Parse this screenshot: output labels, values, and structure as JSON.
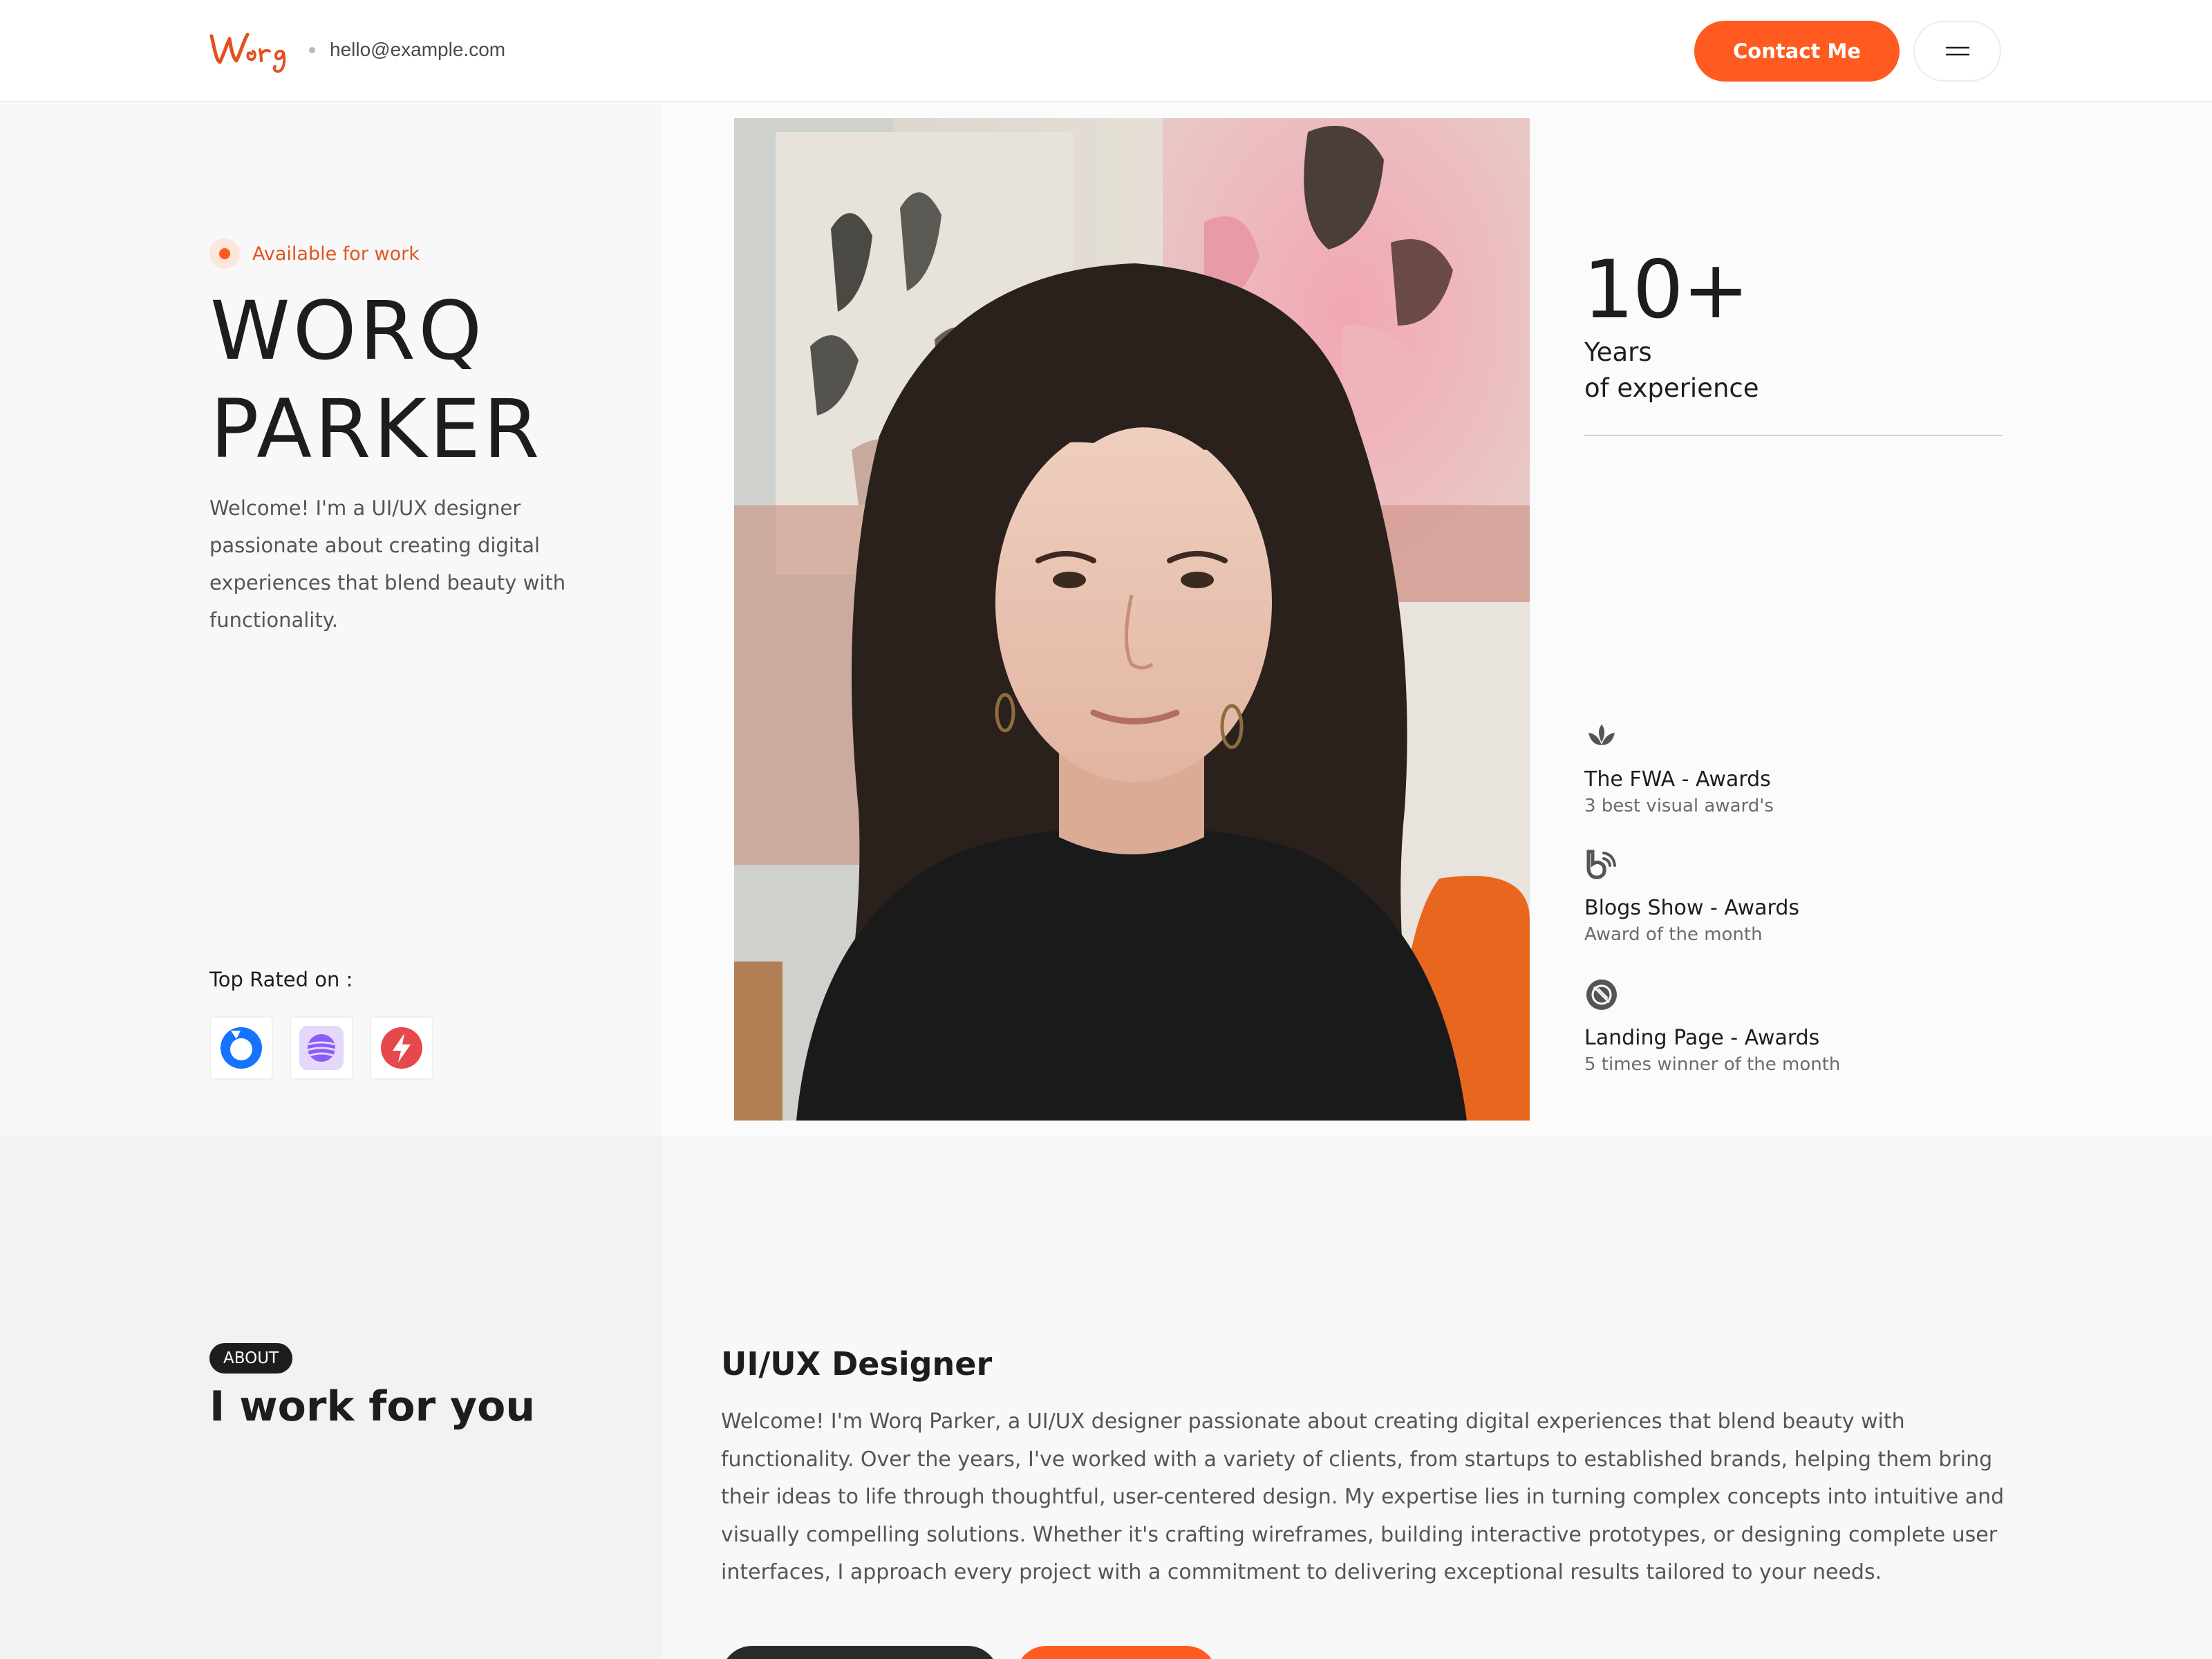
{
  "header": {
    "email": "hello@example.com",
    "contact_label": "Contact Me",
    "accent_color": "#ff5a1f"
  },
  "hero": {
    "availability": "Available for work",
    "name_line1": "WORQ",
    "name_line2": "PARKER",
    "description": "Welcome! I'm a UI/UX designer passionate about creating digital experiences that blend beauty with functionality.",
    "top_rated_label": "Top Rated on :",
    "platforms": [
      {
        "icon": "blue-ring-icon"
      },
      {
        "icon": "purple-sphere-icon"
      },
      {
        "icon": "red-bolt-icon"
      }
    ]
  },
  "stats": {
    "number": "10+",
    "label_line1": "Years",
    "label_line2": "of experience"
  },
  "awards": [
    {
      "icon": "lotus-icon",
      "title": "The FWA - Awards",
      "subtitle": "3 best visual award's"
    },
    {
      "icon": "blog-b-icon",
      "title": "Blogs Show - Awards",
      "subtitle": "Award of the month"
    },
    {
      "icon": "landing-badge-icon",
      "title": "Landing Page - Awards",
      "subtitle": "5 times winner of the month"
    }
  ],
  "about": {
    "badge": "ABOUT",
    "title": "I work for you",
    "role": "UI/UX Designer",
    "text": "Welcome! I'm Worq Parker, a UI/UX designer passionate about creating digital experiences that blend beauty with functionality. Over the years, I've worked with a variety of clients, from startups to established brands, helping them bring their ideas to life through thoughtful, user-centered design. My expertise lies in turning complex concepts into intuitive and visually compelling solutions. Whether it's crafting wireframes, building interactive prototypes, or designing complete user interfaces, I approach every project with a commitment to delivering exceptional results tailored to your needs."
  }
}
